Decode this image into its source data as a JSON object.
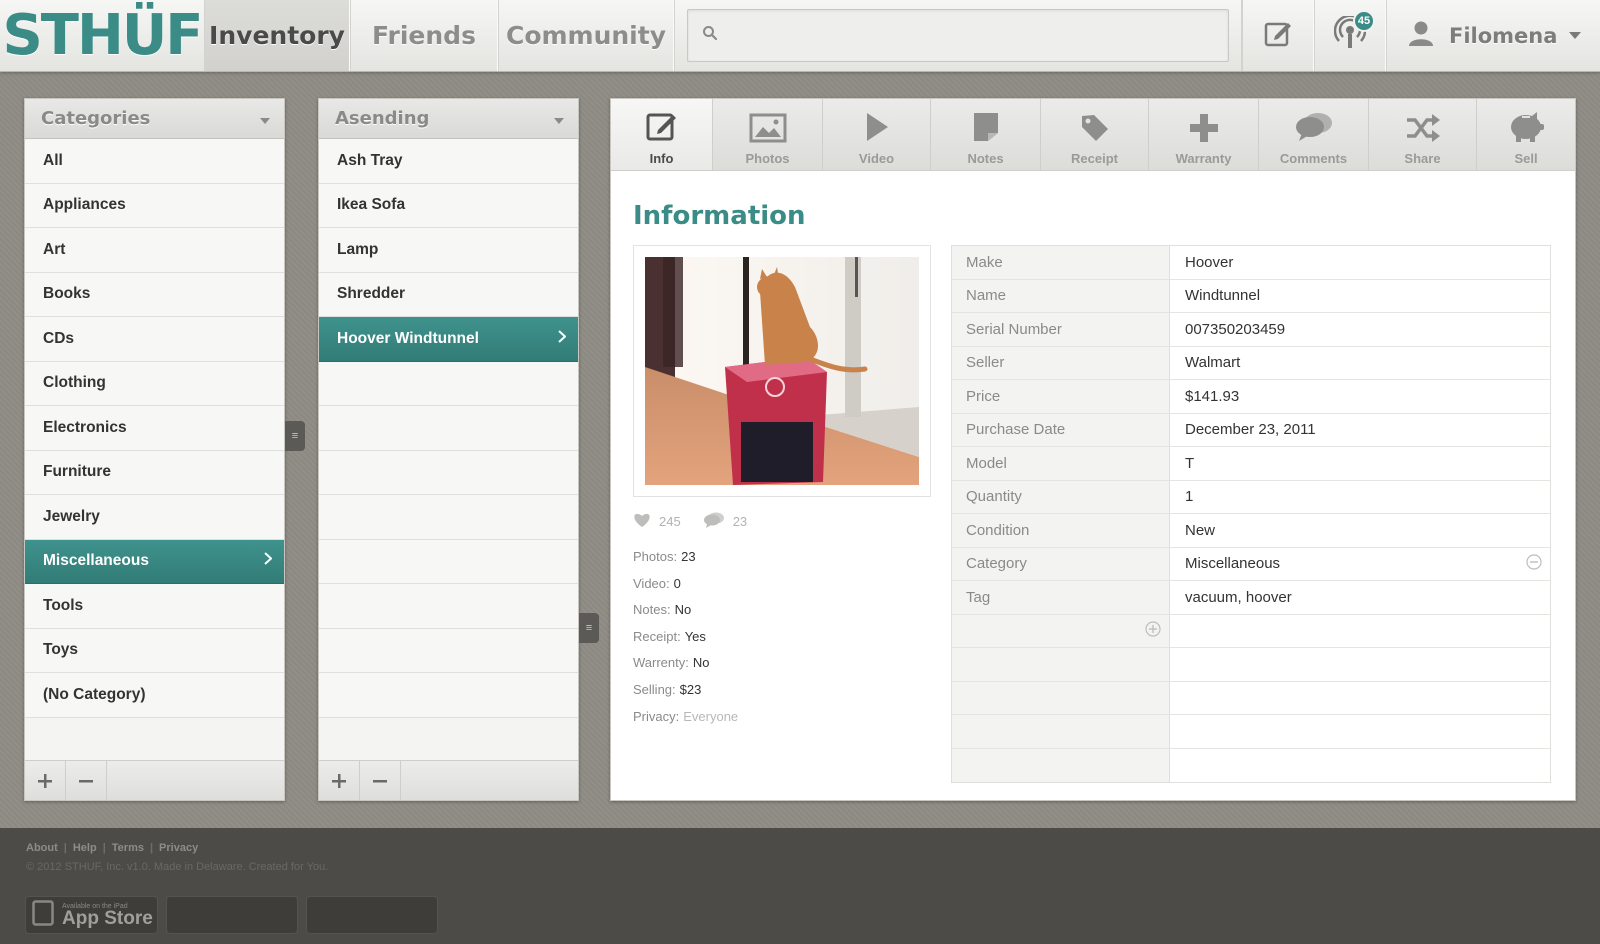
{
  "brand": {
    "logo": "STHÜF"
  },
  "nav": {
    "tabs": [
      "Inventory",
      "Friends",
      "Community"
    ],
    "active": "Inventory"
  },
  "search": {
    "placeholder": "",
    "value": ""
  },
  "notifications": {
    "count": "45"
  },
  "user": {
    "name": "Filomena"
  },
  "categories": {
    "header": "Categories",
    "items": [
      "All",
      "Appliances",
      "Art",
      "Books",
      "CDs",
      "Clothing",
      "Electronics",
      "Furniture",
      "Jewelry",
      "Miscellaneous",
      "Tools",
      "Toys",
      "(No Category)"
    ],
    "selected": "Miscellaneous"
  },
  "items_list": {
    "header": "Asending",
    "items": [
      "Ash Tray",
      "Ikea Sofa",
      "Lamp",
      "Shredder",
      "Hoover Windtunnel"
    ],
    "selected": "Hoover Windtunnel"
  },
  "toolbar": {
    "tabs": [
      {
        "label": "Info",
        "icon": "edit-icon"
      },
      {
        "label": "Photos",
        "icon": "photo-icon"
      },
      {
        "label": "Video",
        "icon": "play-icon"
      },
      {
        "label": "Notes",
        "icon": "note-icon"
      },
      {
        "label": "Receipt",
        "icon": "tag-icon"
      },
      {
        "label": "Warranty",
        "icon": "plus-icon"
      },
      {
        "label": "Comments",
        "icon": "comments-icon"
      },
      {
        "label": "Share",
        "icon": "shuffle-icon"
      },
      {
        "label": "Sell",
        "icon": "piggy-bank-icon"
      }
    ],
    "active": "Info"
  },
  "info": {
    "title": "Information",
    "likes": "245",
    "comments": "23",
    "meta": [
      {
        "label": "Photos:",
        "value": "23"
      },
      {
        "label": "Video:",
        "value": "0"
      },
      {
        "label": "Notes:",
        "value": "No"
      },
      {
        "label": "Receipt:",
        "value": "Yes"
      },
      {
        "label": "Warrenty:",
        "value": "No"
      },
      {
        "label": "Selling:",
        "value": "$23"
      },
      {
        "label": "Privacy:",
        "value": "Everyone"
      }
    ],
    "fields": [
      {
        "key": "Make",
        "value": "Hoover"
      },
      {
        "key": "Name",
        "value": "Windtunnel"
      },
      {
        "key": "Serial Number",
        "value": "007350203459"
      },
      {
        "key": "Seller",
        "value": "Walmart"
      },
      {
        "key": "Price",
        "value": "$141.93"
      },
      {
        "key": "Purchase Date",
        "value": "December 23, 2011"
      },
      {
        "key": "Model",
        "value": "T"
      },
      {
        "key": "Quantity",
        "value": "1"
      },
      {
        "key": "Condition",
        "value": "New"
      },
      {
        "key": "Category",
        "value": "Miscellaneous"
      },
      {
        "key": "Tag",
        "value": "vacuum, hoover"
      }
    ]
  },
  "footer": {
    "links": [
      "About",
      "Help",
      "Terms",
      "Privacy"
    ],
    "copyright": "© 2012 STHUF, Inc. v1.0. Made in Delaware. Created for You.",
    "appstore_small": "Available on the iPad",
    "appstore_big": "App Store"
  },
  "colors": {
    "accent": "#3b8c87",
    "background": "#8f8b85",
    "footer": "#4d4b48"
  }
}
